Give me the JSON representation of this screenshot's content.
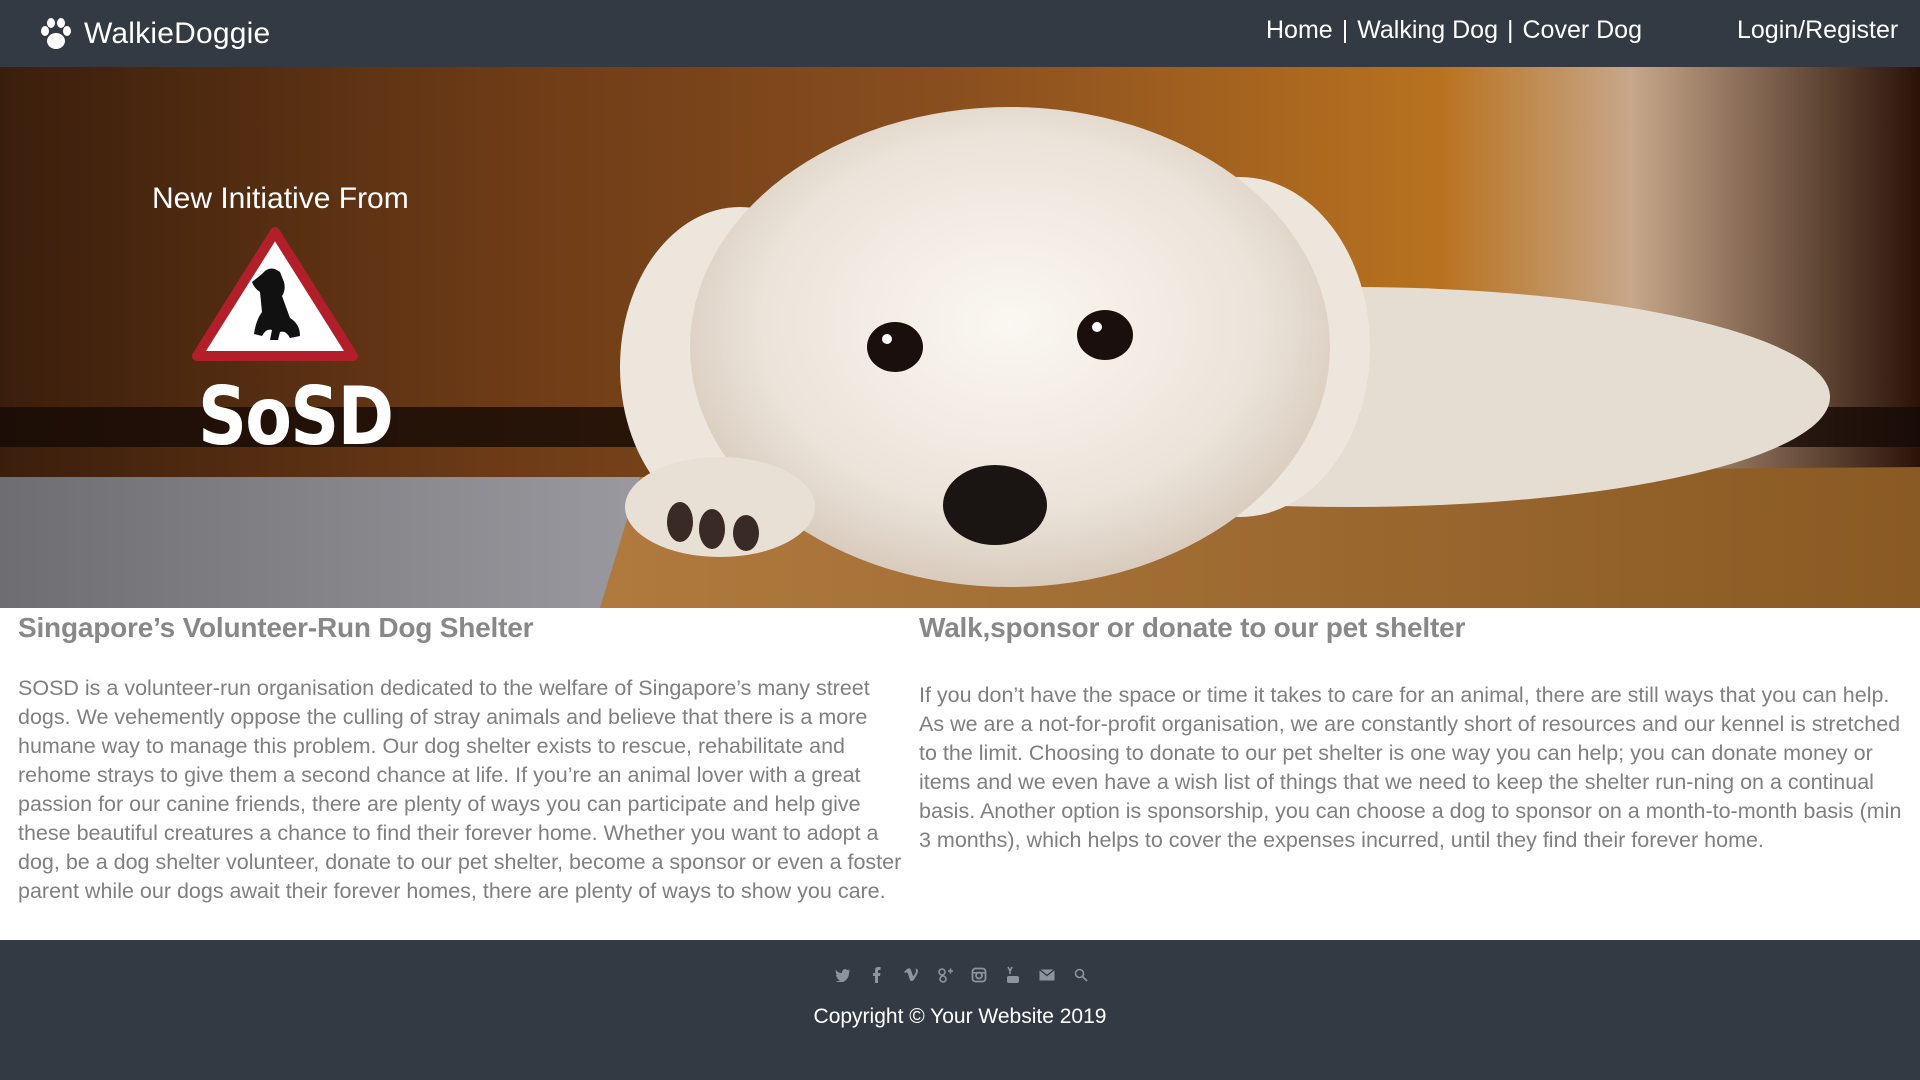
{
  "nav": {
    "brand": "WalkieDoggie",
    "brand_icon": "paw-icon",
    "items": [
      {
        "label": "Home"
      },
      {
        "label": "Walking Dog"
      },
      {
        "label": "Cover Dog"
      }
    ],
    "separator": "|",
    "login": "Login/Register"
  },
  "hero": {
    "subtitle": "New Initiative From",
    "logo_text": "SoSD",
    "logo_icon": "sitting-dog-warning-icon",
    "logo_color": "#b21e2a"
  },
  "left": {
    "heading": "Singapore’s Volunteer-Run Dog Shelter",
    "body": "SOSD is a volunteer-run organisation dedicated to the welfare of Singapore’s many street dogs. We vehemently oppose the culling of stray animals and believe that there is a more humane way to manage this problem. Our dog shelter exists to rescue, rehabilitate and rehome strays to give them a second chance at life. If you’re an animal lover with a great passion for our canine friends, there are plenty of ways you can participate and help give these beautiful creatures a chance to find their forever home. Whether you want to adopt a dog, be a dog shelter volunteer, donate to our pet shelter, become a sponsor or even a foster parent while our dogs await their forever homes, there are plenty of ways to show you care."
  },
  "right": {
    "heading": "Walk,sponsor or donate to our pet shelter",
    "body": "If you don’t have the space or time it takes to care for an animal, there are still ways that you can help. As we are a not-for-profit organisation, we are constantly short of resources and our kennel is stretched to the limit. Choosing to donate to our pet shelter is one way you can help; you can donate money or items and we even have a wish list of things that we need to keep the shelter run-ning on a continual basis. Another option is sponsorship, you can choose a dog to sponsor on a month-to-month basis (min 3 months), which helps to cover the expenses incurred, until they find their forever home."
  },
  "footer": {
    "social_icons": [
      "twitter-icon",
      "facebook-icon",
      "vimeo-icon",
      "google-plus-icon",
      "instagram-icon",
      "youtube-icon",
      "mail-icon",
      "search-icon"
    ],
    "copyright": "Copyright © Your Website 2019"
  },
  "colors": {
    "nav_bg": "#333a44",
    "footer_bg": "#333a44",
    "heading": "#888888",
    "body_text": "#7f7f7f"
  }
}
